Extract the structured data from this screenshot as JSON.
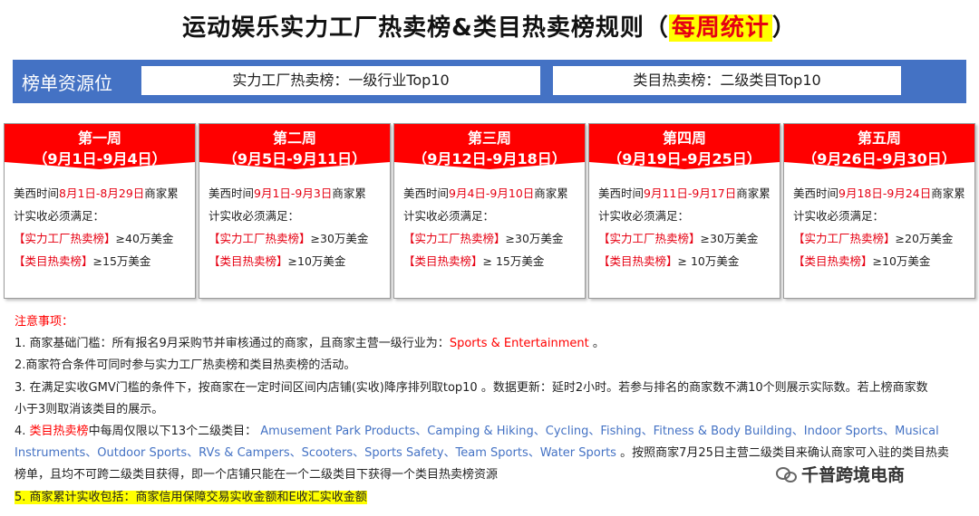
{
  "title": {
    "main": "运动娱乐实力工厂热卖榜&类目热卖榜规则（",
    "highlight": "每周统计",
    "end": "）"
  },
  "resource": {
    "label": "榜单资源位",
    "box1": "实力工厂热卖榜：一级行业Top10",
    "box2": "类目热卖榜：二级类目Top10"
  },
  "weeks": [
    {
      "name": "第一周",
      "range": "（9月1日-9月4日）",
      "pre": "美西时间",
      "window": "8月1日-8月29日",
      "post": "商家累",
      "line2": "计实收必须满足：",
      "factory_label": "【实力工厂热卖榜】",
      "factory_value": "≥40万美金",
      "category_label": "【类目热卖榜】",
      "category_value": "≥15万美金"
    },
    {
      "name": "第二周",
      "range": "（9月5日-9月11日）",
      "pre": "美西时间",
      "window": "9月1日-9月3日",
      "post": "商家累",
      "line2": "计实收必须满足：",
      "factory_label": "【实力工厂热卖榜】",
      "factory_value": "≥30万美金",
      "category_label": "【类目热卖榜】",
      "category_value": "≥10万美金"
    },
    {
      "name": "第三周",
      "range": "（9月12日-9月18日）",
      "pre": "美西时间",
      "window": "9月4日-9月10日",
      "post": "商家累",
      "line2": "计实收必须满足：",
      "factory_label": "【实力工厂热卖榜】",
      "factory_value": "≥30万美金",
      "category_label": "【类目热卖榜】",
      "category_value": "≥ 15万美金"
    },
    {
      "name": "第四周",
      "range": "（9月19日-9月25日）",
      "pre": "美西时间",
      "window": "9月11日-9月17日",
      "post": "商家累",
      "line2": "计实收必须满足：",
      "factory_label": "【实力工厂热卖榜】",
      "factory_value": "≥30万美金",
      "category_label": "【类目热卖榜】",
      "category_value": "≥ 10万美金"
    },
    {
      "name": "第五周",
      "range": "（9月26日-9月30日）",
      "pre": "美西时间",
      "window": "9月18日-9月24日",
      "post": "商家累",
      "line2": "计实收必须满足：",
      "factory_label": "【实力工厂热卖榜】",
      "factory_value": "≥20万美金",
      "category_label": "【类目热卖榜】",
      "category_value": "≥10万美金"
    }
  ],
  "notes": {
    "heading": "注意事项：",
    "n1_a": "1. 商家基础门槛：所有报名9月采购节并审核通过的商家，且商家主营一级行业为：",
    "n1_b": "Sports & Entertainment",
    "n1_c": " 。",
    "n2": "2.商家符合条件可同时参与实力工厂热卖榜和类目热卖榜的活动。",
    "n3_a": "3. 在满足实收GMV门槛的条件下，按商家在一定时间区间内店铺(实收)降序排列取top10 。数据更新：延时2小时。若参与排名的商家数不满10个则展示实际数。若上榜商家数",
    "n3_b": "小于3则取消该类目的展示。",
    "n4_a": "4. ",
    "n4_b": "类目热卖榜",
    "n4_c": "中每周仅限以下13个二级类目： ",
    "n4_d": "Amusement Park Products、Camping & Hiking、Cycling、Fishing、Fitness & Body Building、Indoor Sports、Musical",
    "n4_e": "Instruments、Outdoor Sports、RVs & Campers、Scooters、Sports Safety、Team Sports、Water Sports",
    "n4_f": " 。按照商家7月25日主营二级类目来确认商家可入驻的类目热卖",
    "n4_g": "榜单，且均不可跨二级类目获得，即一个店铺只能在一个二级类目下获得一个类目热卖榜资源",
    "n5": "5. 商家累计实收包括：商家信用保障交易实收金额和E收汇实收金额"
  },
  "watermark": "千普跨境电商"
}
